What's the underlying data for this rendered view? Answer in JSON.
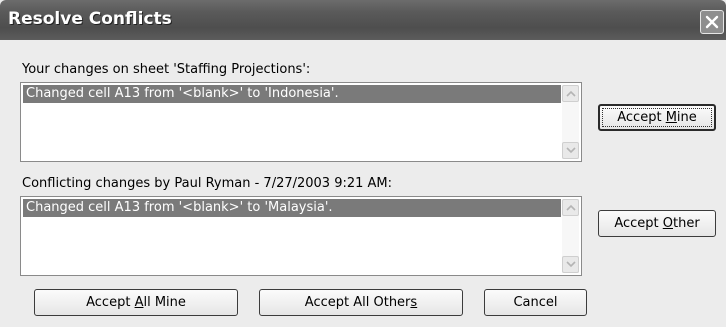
{
  "window": {
    "title": "Resolve Conflicts",
    "close_icon": "close-icon"
  },
  "mine_group": {
    "label": "Your changes on sheet 'Staffing Projections':",
    "items": [
      "Changed cell A13 from '<blank>' to 'Indonesia'."
    ]
  },
  "other_group": {
    "label": "Conflicting changes by Paul Ryman - 7/27/2003 9:21 AM:",
    "items": [
      "Changed cell A13 from '<blank>' to 'Malaysia'."
    ]
  },
  "buttons": {
    "accept_mine": {
      "before": "Accept ",
      "mnemonic": "M",
      "after": "ine"
    },
    "accept_other": {
      "before": "Accept ",
      "mnemonic": "O",
      "after": "ther"
    },
    "accept_all_mine": {
      "before": "Accept ",
      "mnemonic": "A",
      "after": "ll Mine"
    },
    "accept_all_others": {
      "before": "Accept All Other",
      "mnemonic": "s",
      "after": ""
    },
    "cancel": "Cancel"
  },
  "colors": {
    "selection": "#7a7a7a",
    "titlebar": "#5a5a5a",
    "dialog_bg": "#ececec"
  }
}
